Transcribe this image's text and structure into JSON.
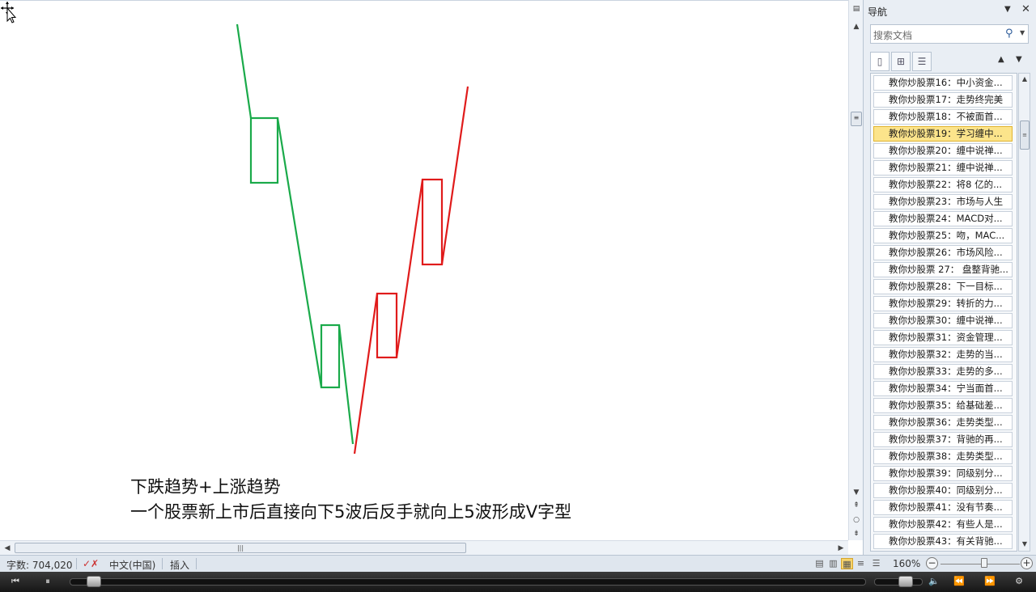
{
  "document": {
    "caption_line1": "下跌趋势+上涨趋势",
    "caption_line2": "一个股票新上市后直接向下5波后反手就向上5波形成V字型",
    "down_color": "#1aaa4a",
    "up_color": "#e01b1b"
  },
  "nav": {
    "title": "导航",
    "search_placeholder": "搜索文档",
    "items": [
      {
        "label": "教你炒股票16：中小资金..."
      },
      {
        "label": "教你炒股票17：走势终完美"
      },
      {
        "label": "教你炒股票18：不被面首..."
      },
      {
        "label": "教你炒股票19：学习缠中...",
        "selected": true
      },
      {
        "label": "教你炒股票20：缠中说禅..."
      },
      {
        "label": "教你炒股票21：缠中说禅..."
      },
      {
        "label": "教你炒股票22：将8 亿的..."
      },
      {
        "label": "教你炒股票23：市场与人生"
      },
      {
        "label": "教你炒股票24：MACD对..."
      },
      {
        "label": "教你炒股票25：吻，MAC..."
      },
      {
        "label": "教你炒股票26：市场风险..."
      },
      {
        "label": "教你炒股票 27： 盘整背驰..."
      },
      {
        "label": "教你炒股票28：下一目标..."
      },
      {
        "label": "教你炒股票29：转折的力..."
      },
      {
        "label": "教你炒股票30：缠中说禅..."
      },
      {
        "label": "教你炒股票31：资金管理..."
      },
      {
        "label": "教你炒股票32：走势的当..."
      },
      {
        "label": "教你炒股票33：走势的多..."
      },
      {
        "label": "教你炒股票34：宁当面首..."
      },
      {
        "label": "教你炒股票35：给基础差..."
      },
      {
        "label": "教你炒股票36：走势类型..."
      },
      {
        "label": "教你炒股票37：背驰的再..."
      },
      {
        "label": "教你炒股票38：走势类型..."
      },
      {
        "label": "教你炒股票39：同级别分..."
      },
      {
        "label": "教你炒股票40：同级别分..."
      },
      {
        "label": "教你炒股票41：没有节奏..."
      },
      {
        "label": "教你炒股票42：有些人是..."
      },
      {
        "label": "教你炒股票43：有关背驰..."
      }
    ]
  },
  "status": {
    "word_count": "字数: 704,020",
    "language": "中文(中国)",
    "mode": "插入",
    "zoom": "160%"
  }
}
